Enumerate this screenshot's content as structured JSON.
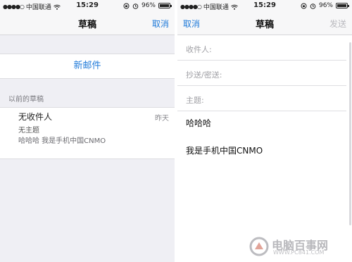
{
  "left_screen": {
    "status": {
      "carrier": "中国联通",
      "time": "15:29",
      "battery": "96%"
    },
    "nav": {
      "title": "草稿",
      "cancel": "取消"
    },
    "new_mail": "新邮件",
    "section_header": "以前的草稿",
    "draft": {
      "recipient": "无收件人",
      "date": "昨天",
      "subject": "无主题",
      "preview": "哈哈哈 我是手机中国CNMO"
    }
  },
  "right_screen": {
    "status": {
      "carrier": "中国联通",
      "time": "15:29",
      "battery": "96%"
    },
    "nav": {
      "cancel": "取消",
      "title": "草稿",
      "send": "发送"
    },
    "fields": {
      "to": "收件人:",
      "cc_bcc": "抄送/密送:",
      "subject": "主题:"
    },
    "body": {
      "line1": "哈哈哈",
      "line2": "我是手机中国CNMO"
    }
  },
  "watermark": {
    "text": "电脑百事网",
    "url": "WWW.PC841.COM"
  },
  "colors": {
    "accent": "#1f7ad9",
    "disabled": "#b9b9be",
    "background": "#efeff4"
  },
  "icons": [
    "signal-dots-icon",
    "wifi-icon",
    "lock-rotation-icon",
    "alarm-icon",
    "battery-icon"
  ]
}
